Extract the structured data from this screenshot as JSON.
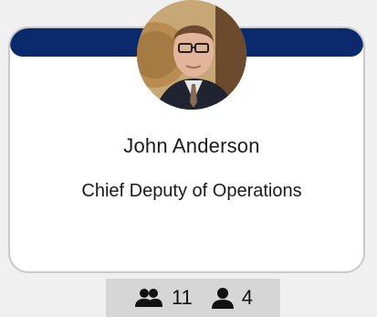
{
  "colors": {
    "band": "#0b2a6e",
    "card_background": "#ffffff",
    "footer_background": "#d6d6d6"
  },
  "profile": {
    "name": "John Anderson",
    "title": "Chief Deputy of Operations",
    "avatar_icon": "person-photo"
  },
  "stats": [
    {
      "icon": "group-icon",
      "value": "11"
    },
    {
      "icon": "person-icon",
      "value": "4"
    }
  ]
}
